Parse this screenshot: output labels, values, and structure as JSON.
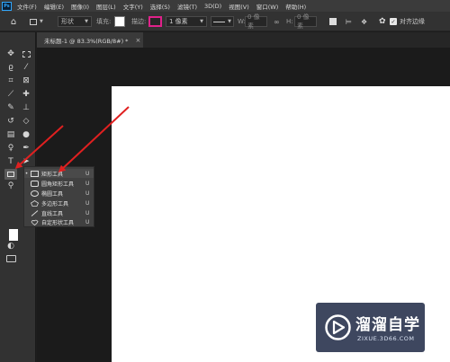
{
  "app": {
    "logo": "Ps"
  },
  "menu": [
    "文件(F)",
    "编辑(E)",
    "图像(I)",
    "图层(L)",
    "文字(Y)",
    "选择(S)",
    "滤镜(T)",
    "3D(D)",
    "视图(V)",
    "窗口(W)",
    "帮助(H)"
  ],
  "options": {
    "home_icon": "home-icon",
    "mode": "形状",
    "fill_label": "填充:",
    "stroke_label": "描边:",
    "stroke_color": "#e0218a",
    "stroke_width": "1 像素",
    "w_label": "W:",
    "w_value": "0 像素",
    "h_label": "H:",
    "h_value": "0 像素",
    "align_edges_label": "对齐边缘"
  },
  "document": {
    "tab_title": "未标题-1 @ 83.3%(RGB/8#) *",
    "close": "×"
  },
  "tools": [
    "move-icon",
    "marquee-icon",
    "lasso-icon",
    "magic-wand-icon",
    "crop-icon",
    "frame-icon",
    "eyedropper-icon",
    "healing-icon",
    "brush-icon",
    "stamp-icon",
    "history-brush-icon",
    "eraser-icon",
    "gradient-icon",
    "blur-icon",
    "dodge-icon",
    "pen-icon",
    "type-icon",
    "path-select-icon",
    "rectangle-tool-icon",
    "hand-icon",
    "zoom-icon",
    "edit-toolbar-icon"
  ],
  "flyout": {
    "items": [
      {
        "label": "矩形工具",
        "key": "U",
        "icon": "rectangle-icon",
        "selected": true
      },
      {
        "label": "圆角矩形工具",
        "key": "U",
        "icon": "rounded-rectangle-icon",
        "selected": false
      },
      {
        "label": "椭圆工具",
        "key": "U",
        "icon": "ellipse-icon",
        "selected": false
      },
      {
        "label": "多边形工具",
        "key": "U",
        "icon": "polygon-icon",
        "selected": false
      },
      {
        "label": "直线工具",
        "key": "U",
        "icon": "line-icon",
        "selected": false
      },
      {
        "label": "自定形状工具",
        "key": "U",
        "icon": "custom-shape-icon",
        "selected": false
      }
    ]
  },
  "colors": {
    "annotation_arrow": "#e02020",
    "foreground": "#ffffff",
    "watermark_bg": "#141e3c"
  },
  "watermark": {
    "title": "溜溜自学",
    "url": "ZIXUE.3D66.COM"
  }
}
